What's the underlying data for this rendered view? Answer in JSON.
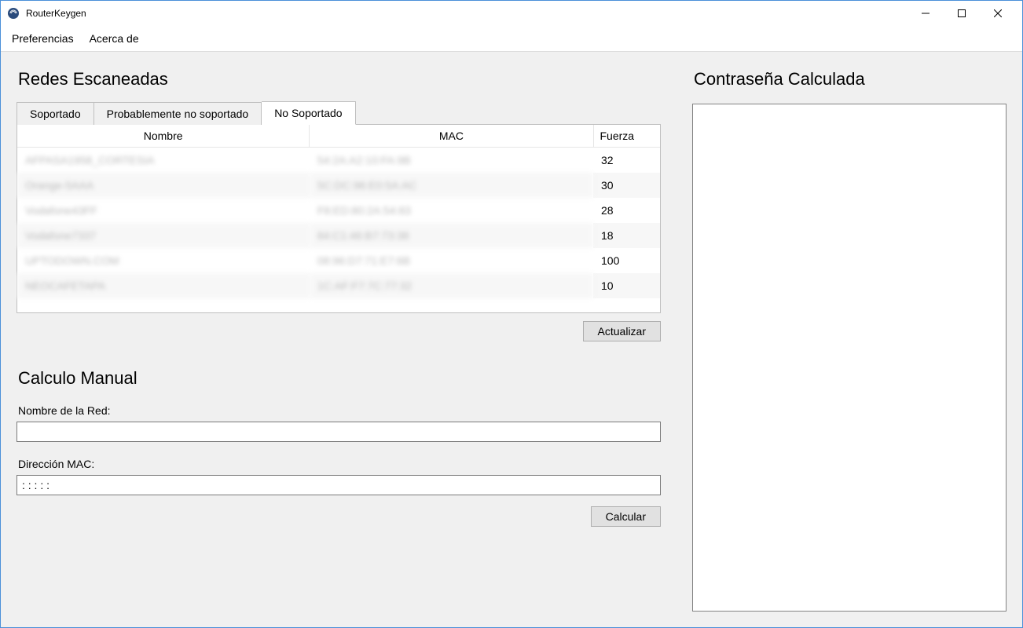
{
  "window": {
    "title": "RouterKeygen"
  },
  "menubar": {
    "items": [
      "Preferencias",
      "Acerca de"
    ]
  },
  "scanned": {
    "heading": "Redes Escaneadas",
    "tabs": [
      "Soportado",
      "Probablemente no soportado",
      "No Soportado"
    ],
    "active_tab": 2,
    "columns": [
      "Nombre",
      "MAC",
      "Fuerza"
    ],
    "rows": [
      {
        "name": "AFPASA1958_CORTESIA",
        "mac": "54:2A:A2:10:FA:9B",
        "strength": "32"
      },
      {
        "name": "Orange-5AAA",
        "mac": "5C:DC:96:E0:5A:AC",
        "strength": "30"
      },
      {
        "name": "Vodafone43FF",
        "mac": "F8:ED:80:2A:54:83",
        "strength": "28"
      },
      {
        "name": "Vodafone7337",
        "mac": "84:C1:46:B7:73:38",
        "strength": "18"
      },
      {
        "name": "UPTODOWN.COM",
        "mac": "08:96:D7:71:E7:6B",
        "strength": "100"
      },
      {
        "name": "NEOCAFETAPA",
        "mac": "1C:AF:F7:7C:77:32",
        "strength": "10"
      }
    ],
    "refresh_label": "Actualizar"
  },
  "manual": {
    "heading": "Calculo Manual",
    "ssid_label": "Nombre de la Red:",
    "ssid_value": "",
    "mac_label": "Dirección MAC:",
    "mac_value": ": : : : :",
    "calc_label": "Calcular"
  },
  "result": {
    "heading": "Contraseña Calculada"
  }
}
